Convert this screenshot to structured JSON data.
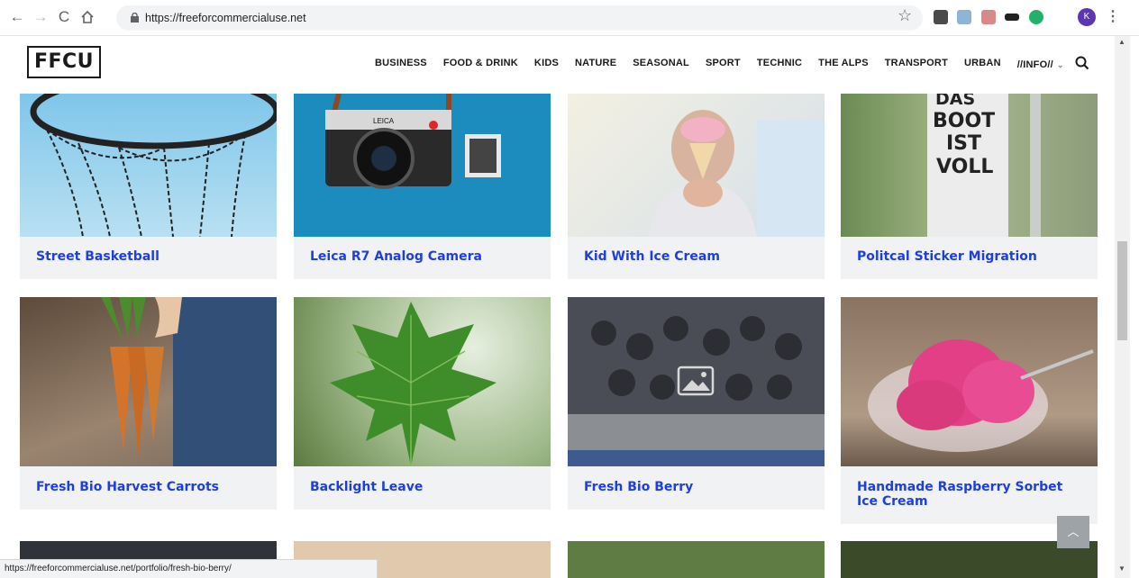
{
  "browser": {
    "url": "https://freeforcommercialuse.net",
    "profile_initial": "K",
    "status_url": "https://freeforcommercialuse.net/portfolio/fresh-bio-berry/"
  },
  "site": {
    "logo": "FFCU",
    "menu": [
      "BUSINESS",
      "FOOD & DRINK",
      "KIDS",
      "NATURE",
      "SEASONAL",
      "SPORT",
      "TECHNIC",
      "THE ALPS",
      "TRANSPORT",
      "URBAN"
    ],
    "menu_info": "//INFO//"
  },
  "cards": [
    {
      "title": "Street Basketball",
      "photo_text": ""
    },
    {
      "title": "Leica R7 Analog Camera",
      "photo_text": "LEICA"
    },
    {
      "title": "Kid With Ice Cream",
      "photo_text": ""
    },
    {
      "title": "Politcal Sticker Migration",
      "photo_text": "DAS BOOT IST VOLL"
    },
    {
      "title": "Fresh Bio Harvest Carrots",
      "photo_text": ""
    },
    {
      "title": "Backlight Leave",
      "photo_text": ""
    },
    {
      "title": "Fresh Bio Berry",
      "photo_text": ""
    },
    {
      "title": "Handmade Raspberry Sorbet Ice Cream",
      "photo_text": ""
    }
  ],
  "colors": {
    "title_blue": "#1f3fdc",
    "card_bg": "#f1f2f4"
  }
}
